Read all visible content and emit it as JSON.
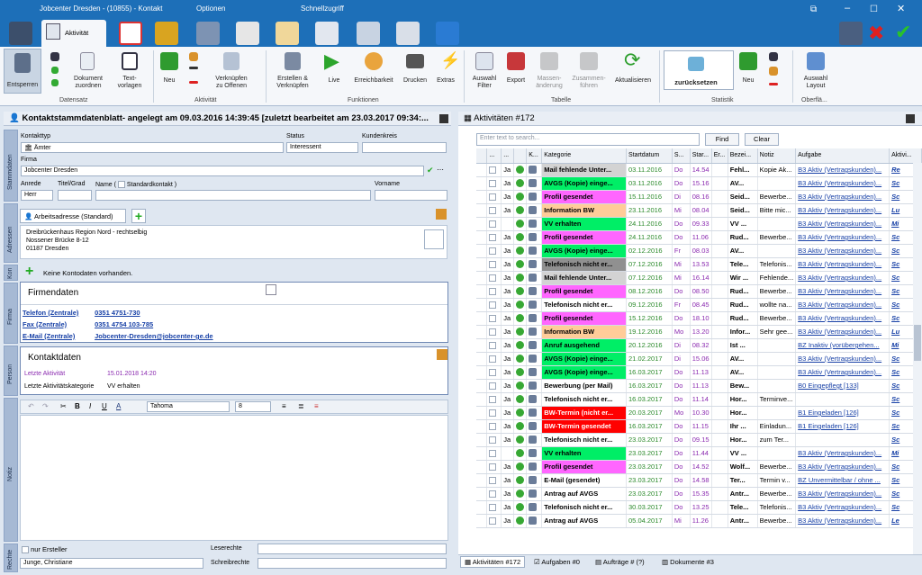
{
  "window": {
    "title": "Jobcenter Dresden -  (10855) - Kontakt",
    "tab_options": "Optionen",
    "tab_quick": "Schnellzugriff",
    "active_tab": "Aktivität"
  },
  "ribbon": {
    "entsperren": "Entsperren",
    "dokument": "Dokument\nzuordnen",
    "textvorlagen": "Text-\nvorlagen",
    "neu": "Neu",
    "verknuepfen": "Verknüpfen\nzu Offenen",
    "erstellen": "Erstellen &\nVerknüpfen",
    "live": "Live",
    "erreichbarkeit": "Erreichbarkeit",
    "drucken": "Drucken",
    "extras": "Extras",
    "auswahl_filter": "Auswahl\nFilter",
    "export": "Export",
    "massen": "Massen-\nänderung",
    "zusammen": "Zusammen-\nführen",
    "aktualisieren": "Aktualisieren",
    "zuruecksetzen": "zurücksetzen",
    "neu2": "Neu",
    "auswahl_layout": "Auswahl\nLayout",
    "groups": {
      "datensatz": "Datensatz",
      "aktivitaet": "Aktivität",
      "funktionen": "Funktionen",
      "tabelle": "Tabelle",
      "statistik": "Statistik",
      "oberflaeche": "Oberflä..."
    }
  },
  "left": {
    "header": "Kontaktstammdatenblatt- angelegt am 09.03.2016 14:39:45 [zuletzt bearbeitet am 23.03.2017 09:34:...",
    "side_tabs": {
      "stammdaten": "Stammdaten",
      "adressen": "Adressen",
      "kon": "Kon",
      "firma": "Firma",
      "person": "Person",
      "notiz": "Notiz",
      "rechte": "Rechte"
    },
    "kontakttyp_label": "Kontakttyp",
    "kontakttyp_value": "Ämter",
    "status_label": "Status",
    "status_value": "Interessent",
    "kundenkreis_label": "Kundenkreis",
    "kundenkreis_value": "",
    "firma_label": "Firma",
    "firma_value": "Jobcenter Dresden",
    "anrede_label": "Anrede",
    "anrede_value": "Herr",
    "titel_label": "Titel/Grad",
    "name_label": "Name (",
    "standardkontakt_label": "Standardkontakt )",
    "vorname_label": "Vorname",
    "address_tab": "Arbeitsadresse (Standard)",
    "address_lines": [
      "Dreibrückenhaus Region Nord - rechtselbig",
      "Nossener Brücke 8-12",
      "01187 Dresden"
    ],
    "no_accounts": "Keine Kontodaten vorhanden.",
    "firmendaten_title": "Firmendaten",
    "firmendaten": [
      {
        "k": "Telefon (Zentrale)",
        "v": "0351 4751-730"
      },
      {
        "k": "Fax (Zentrale)",
        "v": "0351 4754 103-785"
      },
      {
        "k": "E-Mail (Zentrale)",
        "v": "Jobcenter-Dresden@jobcenter-ge.de"
      }
    ],
    "kontaktdaten_title": "Kontaktdaten",
    "letzte_aktivitaet_label": "Letzte Aktivität",
    "letzte_aktivitaet_value": "15.01.2018 14:20",
    "letzte_kat_label": "Letzte Aktivitätskategorie",
    "letzte_kat_value": "VV erhalten",
    "editor_font": "Tahoma",
    "editor_size": "8",
    "nur_ersteller": "nur Ersteller",
    "leserechte": "Leserechte",
    "schreibrechte": "Schreibrechte",
    "user": "Junge, Christiane"
  },
  "right": {
    "header": "Aktivitäten #172",
    "search_placeholder": "Enter text to search...",
    "find": "Find",
    "clear": "Clear",
    "columns": [
      "...",
      "...",
      "K...",
      "Kategorie",
      "Startdatum",
      "S...",
      "Star...",
      "Er...",
      "Bezei...",
      "Notiz",
      "Aufgabe",
      "Aktivi..."
    ],
    "rows": [
      {
        "ja": "Ja",
        "kat": "Mail fehlende Unter...",
        "bg": "#d3d3d3",
        "date": "03.11.2016",
        "day": "Do",
        "time": "14.54",
        "bez": "Fehl...",
        "notiz": "Kopie Ak...",
        "aufg": "B3 Aktiv (Vertragskunden)...",
        "akt": "Re"
      },
      {
        "ja": "Ja",
        "kat": "AVGS (Kopie) einge...",
        "bg": "#00ee66",
        "date": "03.11.2016",
        "day": "Do",
        "time": "15.16",
        "bez": "AV...",
        "notiz": "",
        "aufg": "B3 Aktiv (Vertragskunden)...",
        "akt": "Sc"
      },
      {
        "ja": "Ja",
        "kat": "Profil gesendet",
        "bg": "#ff66ff",
        "date": "15.11.2016",
        "day": "Di",
        "time": "08.16",
        "bez": "Seid...",
        "notiz": "Bewerbe...",
        "aufg": "B3 Aktiv (Vertragskunden)...",
        "akt": "Sc"
      },
      {
        "ja": "Ja",
        "kat": "Information BW",
        "bg": "#ffcc99",
        "date": "23.11.2016",
        "day": "Mi",
        "time": "08.04",
        "bez": "Seid...",
        "notiz": "Bitte mic...",
        "aufg": "B3 Aktiv (Vertragskunden)...",
        "akt": "Lu"
      },
      {
        "ja": "",
        "kat": "VV erhalten",
        "bg": "#00ee66",
        "date": "24.11.2016",
        "day": "Do",
        "time": "09.33",
        "bez": "VV ...",
        "notiz": "",
        "aufg": "B3 Aktiv (Vertragskunden)...",
        "akt": "Mi"
      },
      {
        "ja": "Ja",
        "kat": "Profil gesendet",
        "bg": "#ff66ff",
        "date": "24.11.2016",
        "day": "Do",
        "time": "11.06",
        "bez": "Rud...",
        "notiz": "Bewerbe...",
        "aufg": "B3 Aktiv (Vertragskunden)...",
        "akt": "Sc"
      },
      {
        "ja": "Ja",
        "kat": "AVGS (Kopie) einge...",
        "bg": "#00ee66",
        "date": "02.12.2016",
        "day": "Fr",
        "time": "08.03",
        "bez": "AV...",
        "notiz": "",
        "aufg": "B3 Aktiv (Vertragskunden)...",
        "akt": "Sc"
      },
      {
        "ja": "Ja",
        "kat": "Telefonisch nicht er...",
        "bg": "#909090",
        "date": "07.12.2016",
        "day": "Mi",
        "time": "13.53",
        "bez": "Tele...",
        "notiz": "Telefonis...",
        "aufg": "B3 Aktiv (Vertragskunden)...",
        "akt": "Sc"
      },
      {
        "ja": "Ja",
        "kat": "Mail fehlende Unter...",
        "bg": "#d3d3d3",
        "date": "07.12.2016",
        "day": "Mi",
        "time": "16.14",
        "bez": "Wir ...",
        "notiz": "Fehlende...",
        "aufg": "B3 Aktiv (Vertragskunden)...",
        "akt": "Sc"
      },
      {
        "ja": "Ja",
        "kat": "Profil gesendet",
        "bg": "#ff66ff",
        "date": "08.12.2016",
        "day": "Do",
        "time": "08.50",
        "bez": "Rud...",
        "notiz": "Bewerbe...",
        "aufg": "B3 Aktiv (Vertragskunden)...",
        "akt": "Sc"
      },
      {
        "ja": "Ja",
        "kat": "Telefonisch nicht er...",
        "bg": "#ffffff",
        "date": "09.12.2016",
        "day": "Fr",
        "time": "08.45",
        "bez": "Rud...",
        "notiz": "wollte na...",
        "aufg": "B3 Aktiv (Vertragskunden)...",
        "akt": "Sc"
      },
      {
        "ja": "Ja",
        "kat": "Profil gesendet",
        "bg": "#ff66ff",
        "date": "15.12.2016",
        "day": "Do",
        "time": "18.10",
        "bez": "Rud...",
        "notiz": "Bewerbe...",
        "aufg": "B3 Aktiv (Vertragskunden)...",
        "akt": "Sc"
      },
      {
        "ja": "Ja",
        "kat": "Information BW",
        "bg": "#ffcc99",
        "date": "19.12.2016",
        "day": "Mo",
        "time": "13.20",
        "bez": "Infor...",
        "notiz": "Sehr gee...",
        "aufg": "B3 Aktiv (Vertragskunden)...",
        "akt": "Lu"
      },
      {
        "ja": "Ja",
        "kat": "Anruf ausgehend",
        "bg": "#00ee66",
        "date": "20.12.2016",
        "day": "Di",
        "time": "08.32",
        "bez": "Ist ...",
        "notiz": "",
        "aufg": "BZ Inaktiv (vorübergehen...",
        "akt": "Mi"
      },
      {
        "ja": "Ja",
        "kat": "AVGS (Kopie) einge...",
        "bg": "#00ee66",
        "date": "21.02.2017",
        "day": "Di",
        "time": "15.06",
        "bez": "AV...",
        "notiz": "",
        "aufg": "B3 Aktiv (Vertragskunden)...",
        "akt": "Sc"
      },
      {
        "ja": "Ja",
        "kat": "AVGS (Kopie) einge...",
        "bg": "#00ee66",
        "date": "16.03.2017",
        "day": "Do",
        "time": "11.13",
        "bez": "AV...",
        "notiz": "",
        "aufg": "B3 Aktiv (Vertragskunden)...",
        "akt": "Sc"
      },
      {
        "ja": "Ja",
        "kat": "Bewerbung (per Mail)",
        "bg": "#ffffff",
        "date": "16.03.2017",
        "day": "Do",
        "time": "11.13",
        "bez": "Bew...",
        "notiz": "",
        "aufg": "B0 Eingepflegt [133]",
        "akt": "Sc"
      },
      {
        "ja": "Ja",
        "kat": "Telefonisch nicht er...",
        "bg": "#ffffff",
        "date": "16.03.2017",
        "day": "Do",
        "time": "11.14",
        "bez": "Hor...",
        "notiz": "Terminve...",
        "aufg": "",
        "akt": "Sc"
      },
      {
        "ja": "Ja",
        "kat": "BW-Termin (nicht er...",
        "bg": "#ff0000",
        "date": "20.03.2017",
        "day": "Mo",
        "time": "10.30",
        "bez": "Hor...",
        "notiz": "",
        "aufg": "B1 Eingeladen [126]",
        "akt": "Sc"
      },
      {
        "ja": "Ja",
        "kat": "BW-Termin gesendet",
        "bg": "#ff0000",
        "date": "16.03.2017",
        "day": "Do",
        "time": "11.15",
        "bez": "Ihr ...",
        "notiz": "Einladun...",
        "aufg": "B1 Eingeladen [126]",
        "akt": "Sc"
      },
      {
        "ja": "Ja",
        "kat": "Telefonisch nicht er...",
        "bg": "#ffffff",
        "date": "23.03.2017",
        "day": "Do",
        "time": "09.15",
        "bez": "Hor...",
        "notiz": "zum Ter...",
        "aufg": "",
        "akt": "Sc"
      },
      {
        "ja": "",
        "kat": "VV erhalten",
        "bg": "#00ee66",
        "date": "23.03.2017",
        "day": "Do",
        "time": "11.44",
        "bez": "VV ...",
        "notiz": "",
        "aufg": "B3 Aktiv (Vertragskunden)...",
        "akt": "Mi"
      },
      {
        "ja": "Ja",
        "kat": "Profil gesendet",
        "bg": "#ff66ff",
        "date": "23.03.2017",
        "day": "Do",
        "time": "14.52",
        "bez": "Wolf...",
        "notiz": "Bewerbe...",
        "aufg": "B3 Aktiv (Vertragskunden)...",
        "akt": "Sc"
      },
      {
        "ja": "Ja",
        "kat": "E-Mail (gesendet)",
        "bg": "#ffffff",
        "date": "23.03.2017",
        "day": "Do",
        "time": "14.58",
        "bez": "Ter...",
        "notiz": "Termin v...",
        "aufg": "BZ Unvermittelbar / ohne ...",
        "akt": "Sc"
      },
      {
        "ja": "Ja",
        "kat": "Antrag auf AVGS",
        "bg": "#ffffff",
        "date": "23.03.2017",
        "day": "Do",
        "time": "15.35",
        "bez": "Antr...",
        "notiz": "Bewerbe...",
        "aufg": "B3 Aktiv (Vertragskunden)...",
        "akt": "Sc"
      },
      {
        "ja": "Ja",
        "kat": "Telefonisch nicht er...",
        "bg": "#ffffff",
        "date": "30.03.2017",
        "day": "Do",
        "time": "13.25",
        "bez": "Tele...",
        "notiz": "Telefonis...",
        "aufg": "B3 Aktiv (Vertragskunden)...",
        "akt": "Sc"
      },
      {
        "ja": "Ja",
        "kat": "Antrag auf AVGS",
        "bg": "#ffffff",
        "date": "05.04.2017",
        "day": "Mi",
        "time": "11.26",
        "bez": "Antr...",
        "notiz": "Bewerbe...",
        "aufg": "B3 Aktiv (Vertragskunden)...",
        "akt": "Le"
      }
    ],
    "bottom_tabs": [
      "Aktivitäten #172",
      "Aufgaben #0",
      "Aufträge # (?)",
      "Dokumente #3"
    ]
  }
}
